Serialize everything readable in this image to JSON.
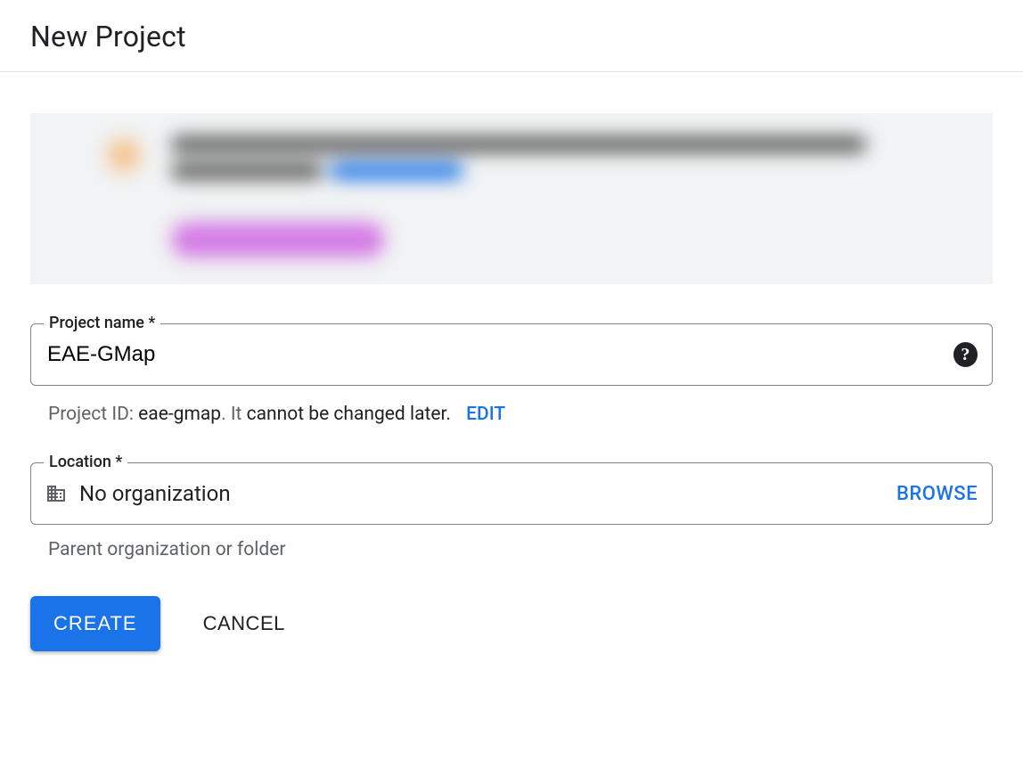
{
  "header": {
    "title": "New Project"
  },
  "form": {
    "project_name": {
      "label": "Project name *",
      "value": "EAE-GMap"
    },
    "project_id_line": {
      "prefix": "Project ID: ",
      "id": "eae-gmap",
      "suffix1": ". It ",
      "emph": "cannot be changed later.",
      "edit": "EDIT"
    },
    "location": {
      "label": "Location *",
      "value": "No organization",
      "browse": "BROWSE",
      "helper": "Parent organization or folder"
    }
  },
  "buttons": {
    "create": "CREATE",
    "cancel": "CANCEL"
  }
}
